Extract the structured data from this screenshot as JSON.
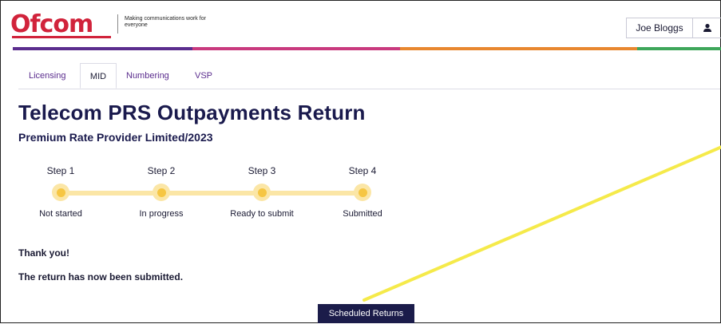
{
  "header": {
    "logo_text": "Ofcom",
    "tagline": "Making communications work for everyone",
    "user_name": "Joe Bloggs",
    "user_icon": "user-icon"
  },
  "tabs": [
    {
      "label": "Licensing",
      "active": false
    },
    {
      "label": "MID",
      "active": true
    },
    {
      "label": "Numbering",
      "active": false
    },
    {
      "label": "VSP",
      "active": false
    }
  ],
  "page": {
    "title": "Telecom PRS Outpayments Return",
    "subtitle": "Premium Rate Provider Limited/2023"
  },
  "stepper": {
    "steps": [
      {
        "number": "Step 1",
        "label": "Not started"
      },
      {
        "number": "Step 2",
        "label": "In progress"
      },
      {
        "number": "Step 3",
        "label": "Ready to submit"
      },
      {
        "number": "Step 4",
        "label": "Submitted"
      }
    ]
  },
  "messages": {
    "thanks": "Thank you!",
    "submitted": "The return has now been submitted."
  },
  "actions": {
    "scheduled_returns": "Scheduled Returns"
  },
  "colors": {
    "brand_red": "#d1233b",
    "tab_purple": "#5b2d8e",
    "navy": "#1b1c4a",
    "step_yellow": "#f6c643",
    "annotation_yellow": "#f5ea4a",
    "rainbow": [
      "#5b2d8e",
      "#c93a7e",
      "#e8872f",
      "#3ea65a"
    ]
  }
}
